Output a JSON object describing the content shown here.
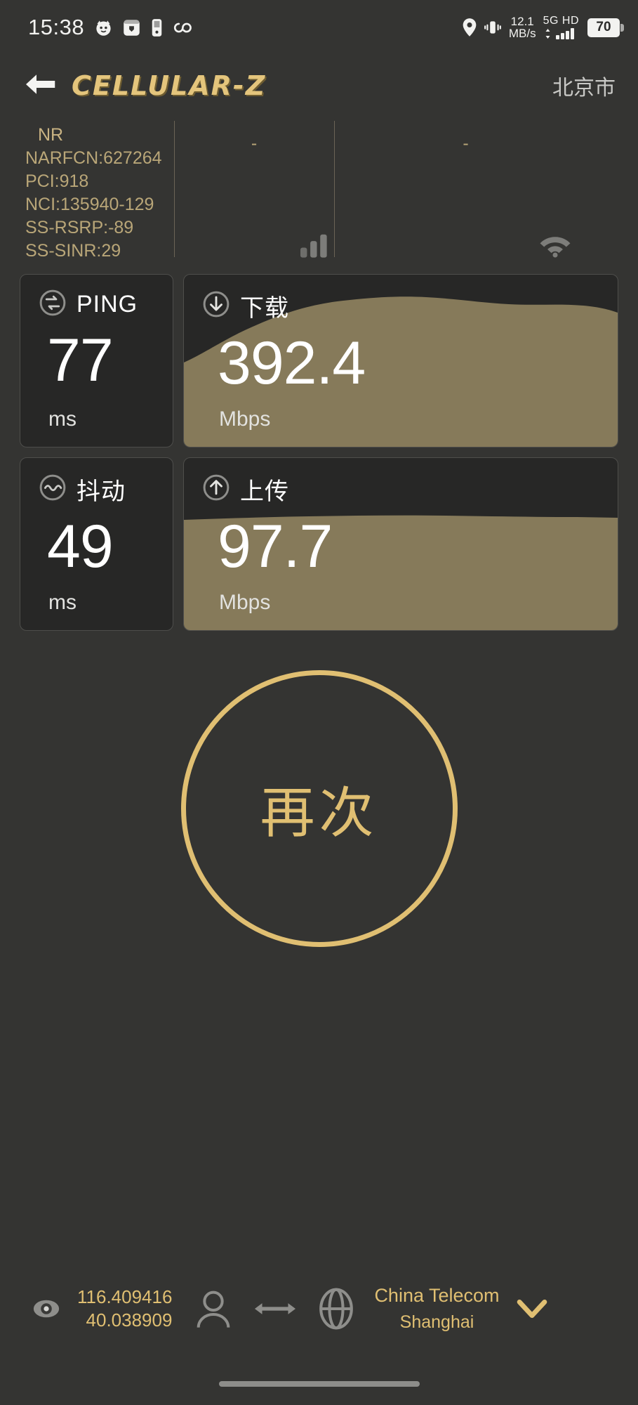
{
  "status_bar": {
    "time": "15:38",
    "left_icons": [
      "cat-face-icon",
      "wallet-icon",
      "phone-card-icon",
      "sync-infinity-icon"
    ],
    "right_icons": [
      "location-pin-icon",
      "vibrate-icon"
    ],
    "net_speed_value": "12.1",
    "net_speed_unit": "MB/s",
    "network_label": "5G HD",
    "battery_level": "70"
  },
  "header": {
    "back_icon": "arrow-left-icon",
    "app_title": "CELLULAR-Z",
    "city": "北京市"
  },
  "cell_info": {
    "column1": {
      "rat": "NR",
      "lines": [
        "NARFCN:627264",
        "PCI:918",
        "NCI:135940-129",
        "SS-RSRP:-89",
        "SS-SINR:29"
      ],
      "signal_icon": "signal-bars-icon"
    },
    "column2": {
      "placeholder": "-",
      "signal_icon": "signal-bars-icon"
    },
    "column3": {
      "placeholder": "-",
      "signal_icon": "wifi-icon"
    }
  },
  "metrics": [
    {
      "id": "ping",
      "icon": "ping-circle-icon",
      "title": "PING",
      "value": "77",
      "unit": "ms",
      "has_graph": false
    },
    {
      "id": "download",
      "icon": "download-circle-icon",
      "title": "下载",
      "value": "392.4",
      "unit": "Mbps",
      "has_graph": true
    },
    {
      "id": "jitter",
      "icon": "jitter-circle-icon",
      "title": "抖动",
      "value": "49",
      "unit": "ms",
      "has_graph": false
    },
    {
      "id": "upload",
      "icon": "upload-circle-icon",
      "title": "上传",
      "value": "97.7",
      "unit": "Mbps",
      "has_graph": true
    }
  ],
  "again_button": {
    "label": "再次"
  },
  "footer": {
    "eye_icon": "eye-icon",
    "latitude": "116.409416",
    "longitude": "40.038909",
    "person_icon": "person-icon",
    "arrows_icon": "left-right-arrow-icon",
    "globe_icon": "globe-icon",
    "isp_name": "China Telecom",
    "isp_location": "Shanghai",
    "chevron_icon": "chevron-down-icon"
  },
  "colors": {
    "background": "#343432",
    "card_bg": "#272726",
    "accent_gold": "#e0bf72",
    "graph_fill": "#867a5a",
    "cell_text": "#b9a678"
  },
  "chart_data": {
    "type": "area",
    "title": "Speed test throughput",
    "series": [
      {
        "name": "下载",
        "unit": "Mbps",
        "final_value": 392.4,
        "fill_color": "#867a5a",
        "normalized_profile": [
          0.62,
          0.72,
          0.8,
          0.86,
          0.9,
          0.93,
          0.94,
          0.95,
          0.94,
          0.93,
          0.93,
          0.9,
          0.88
        ]
      },
      {
        "name": "上传",
        "unit": "Mbps",
        "final_value": 97.7,
        "fill_color": "#867a5a",
        "normalized_profile": [
          0.8,
          0.81,
          0.81,
          0.82,
          0.82,
          0.82,
          0.82,
          0.83,
          0.83,
          0.82,
          0.82,
          0.82,
          0.82
        ]
      }
    ],
    "grid": false,
    "legend": "none"
  }
}
